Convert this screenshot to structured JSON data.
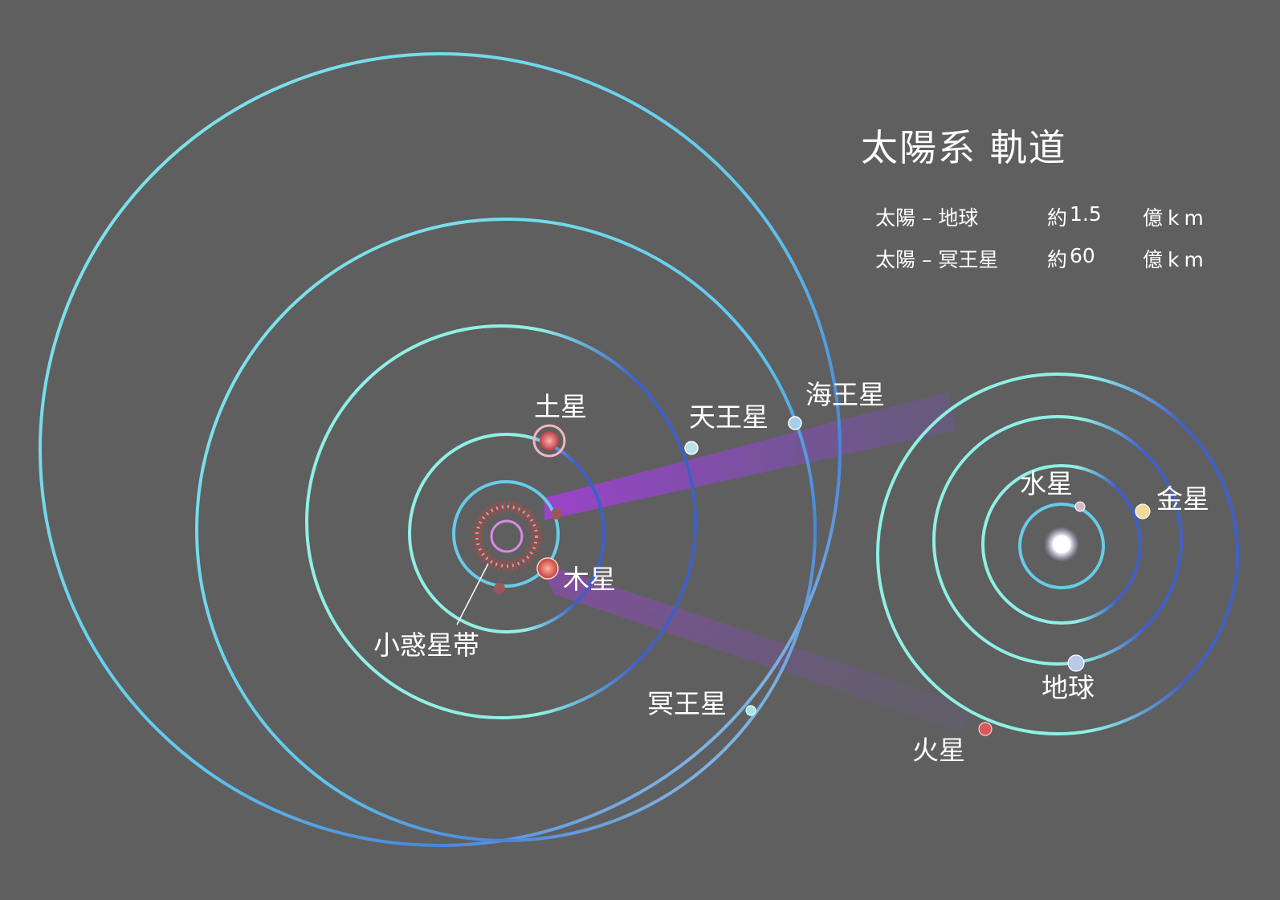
{
  "title": "太陽系 軌道",
  "distances": [
    {
      "pair": "太陽 – 地球",
      "approx": "約",
      "value": "1.5",
      "unit": "億km"
    },
    {
      "pair": "太陽 – 冥王星",
      "approx": "約",
      "value": "60",
      "unit": "億km"
    }
  ],
  "labels": {
    "neptune": "海王星",
    "uranus": "天王星",
    "saturn": "土星",
    "jupiter": "木星",
    "asteroid_belt": "小惑星帯",
    "pluto": "冥王星",
    "mercury": "水星",
    "venus": "金星",
    "earth": "地球",
    "mars": "火星"
  },
  "colors": {
    "background": "#5f5f5f",
    "orbit_light": "#7fe3e6",
    "orbit_dark": "#3f5fc8",
    "beam": "#9a3fd0",
    "sun": "#ffffff",
    "saturn": "#d86b6b",
    "jupiter": "#e66a5c",
    "mars": "#d8585a",
    "earth": "#b9c9e8",
    "venus": "#f2d9a0",
    "mercury": "#d6b8c8",
    "uranus": "#b8e2ea",
    "neptune": "#a8cde6",
    "pluto": "#a0e6e6"
  }
}
